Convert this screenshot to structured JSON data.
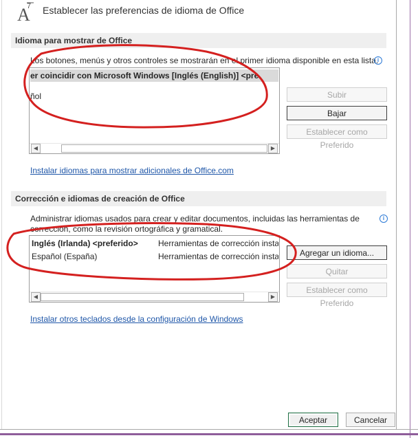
{
  "dialog": {
    "title": "Establecer las preferencias de idioma de Office"
  },
  "display_section": {
    "title": "Idioma para mostrar de Office",
    "description": "Los botones, menús y otros controles se mostrarán en el primer idioma disponible en esta lista.",
    "rows": [
      "er coincidir con Microsoft Windows [Inglés (English)] <pre",
      "ñol"
    ],
    "buttons": {
      "up": "Subir",
      "down": "Bajar",
      "set_preferred": "Establecer como Preferido"
    },
    "install_link": "Instalar idiomas para mostrar adicionales de Office.com"
  },
  "authoring_section": {
    "title": "Corrección e idiomas de creación de Office",
    "description_line1": "Administrar idiomas usados para crear y editar documentos, incluidas las herramientas de",
    "description_line2": "corrección, como la revisión ortográfica y gramatical.",
    "rows": [
      {
        "language": "Inglés (Irlanda) <preferido>",
        "tools": "Herramientas de corrección instal"
      },
      {
        "language": "Español (España)",
        "tools": "Herramientas de corrección instal"
      }
    ],
    "buttons": {
      "add": "Agregar un idioma...",
      "remove": "Quitar",
      "set_preferred": "Establecer como Preferido"
    },
    "keyboards_link": "Instalar otros teclados desde la configuración de Windows"
  },
  "footer": {
    "ok": "Aceptar",
    "cancel": "Cancelar"
  },
  "annotation_color": "#d4201f"
}
